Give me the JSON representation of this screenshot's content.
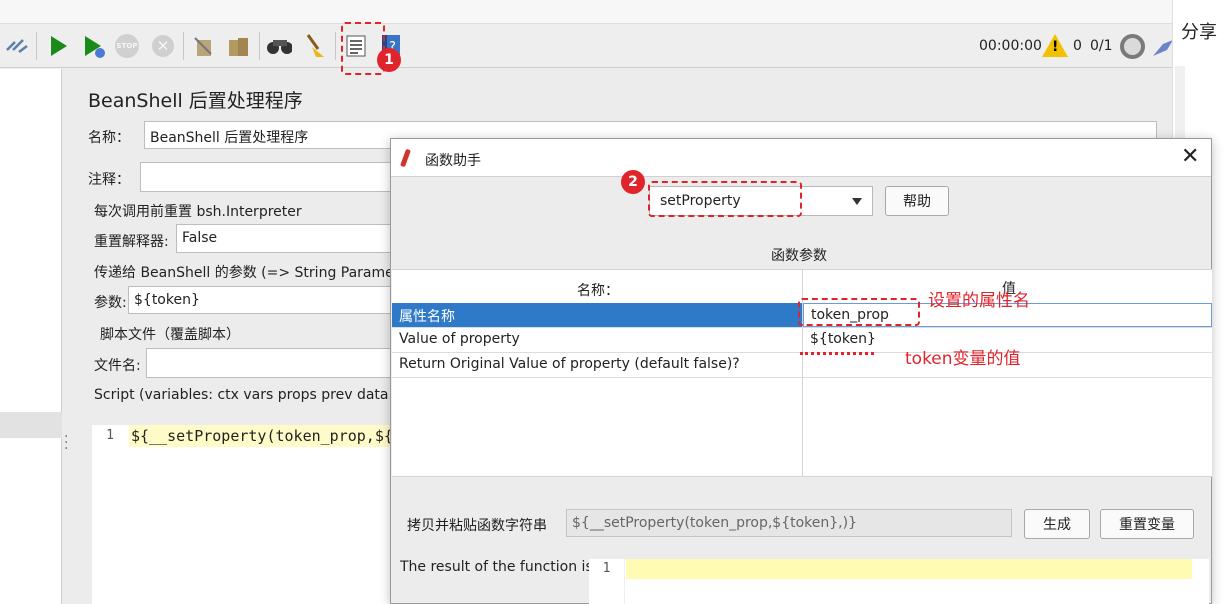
{
  "toolbar": {
    "icons": [
      "connect-icon",
      "start-icon",
      "start-no-pause-icon",
      "stop-icon",
      "shutdown-icon",
      "clear-icon",
      "clear-all-icon",
      "search-icon",
      "reset-search-icon",
      "function-helper-icon",
      "help-icon"
    ],
    "stop_label": "STOP",
    "timer": "00:00:00",
    "warn_count": "0",
    "threads": "0/1"
  },
  "right": {
    "share": "分享"
  },
  "panel": {
    "title": "BeanShell 后置处理程序",
    "name_label": "名称：",
    "name_value": "BeanShell 后置处理程序",
    "comment_label": "注释：",
    "reset_section": "每次调用前重置 bsh.Interpreter",
    "reset_label": "重置解释器:",
    "reset_value": "False",
    "params_section": "传递给 BeanShell 的参数 (=> String Paramete",
    "params_label": "参数:",
    "params_value": "${token}",
    "script_file_section": "脚本文件（覆盖脚本）",
    "filename_label": "文件名:",
    "script_label": "Script (variables: ctx vars props prev data log",
    "line_no": "1",
    "code": "${__setProperty(token_prop,${"
  },
  "dialog": {
    "title": "函数助手",
    "function_selected": "setProperty",
    "help_button": "帮助",
    "params_heading": "函数参数",
    "col_name": "名称：",
    "col_value": "值",
    "rows": [
      {
        "name": "属性名称",
        "value": "token_prop"
      },
      {
        "name": "Value of property",
        "value": "${token}"
      },
      {
        "name": "Return Original Value of property (default false)?",
        "value": ""
      }
    ],
    "copy_label": "拷贝并粘贴函数字符串",
    "copy_value": "${__setProperty(token_prop,${token},)}",
    "generate_button": "生成",
    "reset_button": "重置变量",
    "result_label": "The result of the function is",
    "result_line_no": "1"
  },
  "annotations": {
    "badge1": "1",
    "badge2": "2",
    "note_prop_name": "设置的属性名",
    "note_token_value": "token变量的值",
    "accent": "#e0242c"
  }
}
